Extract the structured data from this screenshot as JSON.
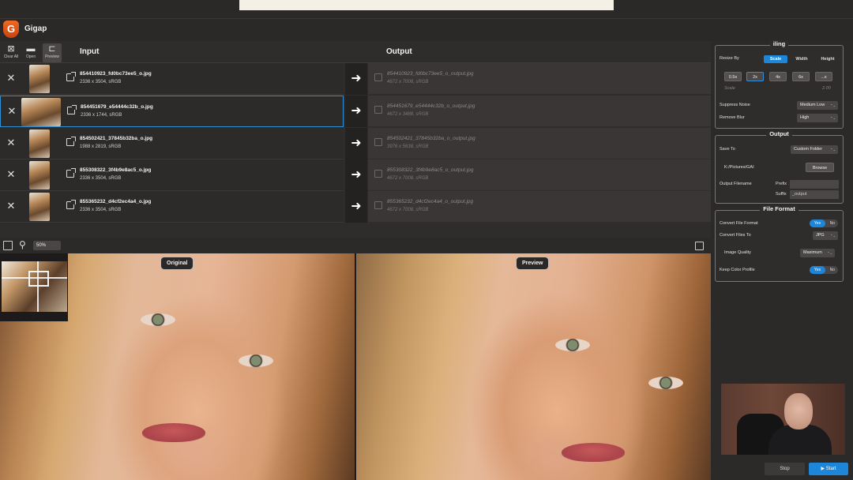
{
  "app": {
    "name": "Gigap",
    "logo_letter": "G"
  },
  "toolbar": {
    "clear_all": "Clear All",
    "open": "Open",
    "preview": "Preview"
  },
  "columns": {
    "input": "Input",
    "output": "Output"
  },
  "rows": [
    {
      "in_name": "854410923_fd0bc73ee5_o.jpg",
      "in_meta": "2336 x 3504, sRGB",
      "out_name": "854410923_fd0bc73ee5_o_output.jpg",
      "out_meta": "4672 x 7008, sRGB"
    },
    {
      "in_name": "854451679_e54444c32b_o.jpg",
      "in_meta": "2336 x 1744, sRGB",
      "out_name": "854451679_e54444c32b_o_output.jpg",
      "out_meta": "4672 x 3488, sRGB"
    },
    {
      "in_name": "854502421_37845b32ba_o.jpg",
      "in_meta": "1988 x 2819, sRGB",
      "out_name": "854502421_37845b32ba_o_output.jpg",
      "out_meta": "3976 x 5638, sRGB"
    },
    {
      "in_name": "855308322_3f4b9e8ac5_o.jpg",
      "in_meta": "2336 x 3504, sRGB",
      "out_name": "855308322_3f4b9e8ac5_o_output.jpg",
      "out_meta": "4672 x 7008, sRGB"
    },
    {
      "in_name": "855365232_d4cf2ec4a4_o.jpg",
      "in_meta": "2336 x 3504, sRGB",
      "out_name": "855365232_d4cf2ec4a4_o_output.jpg",
      "out_meta": "4672 x 7008, sRGB"
    }
  ],
  "preview": {
    "zoom": "50%",
    "original_label": "Original",
    "preview_label": "Preview"
  },
  "resize": {
    "title": "iling",
    "resize_by_label": "Resize By",
    "modes": [
      "Scale",
      "Width",
      "Height"
    ],
    "active_mode": "Scale",
    "factors": [
      "0.5x",
      "2x",
      "4x",
      "6x",
      "...x"
    ],
    "active_factor": "2x",
    "scale_label": "Scale",
    "scale_value": "2.00",
    "suppress_noise_label": "Suppress Noise",
    "suppress_noise_value": "Medium Low",
    "remove_blur_label": "Remove Blur",
    "remove_blur_value": "High"
  },
  "output": {
    "title": "Output",
    "save_to_label": "Save To",
    "save_to_value": "Custom Folder",
    "path": "K:/Pictures/GAI",
    "browse": "Browse",
    "filename_label": "Output Filename",
    "prefix_label": "Prefix",
    "suffix_label": "Suffix",
    "suffix_value": "_output"
  },
  "file_format": {
    "title": "File Format",
    "convert_label": "Convert File Format",
    "yes": "Yes",
    "no": "No",
    "convert_to_label": "Convert Files To",
    "convert_to_value": "JPG",
    "quality_label": "Image Quality",
    "quality_value": "Maximum",
    "keep_profile_label": "Keep Color Profile"
  },
  "actions": {
    "stop": "Stop",
    "start": "Start"
  },
  "colors": {
    "accent": "#1e86d8",
    "logo": "#e2561a"
  }
}
